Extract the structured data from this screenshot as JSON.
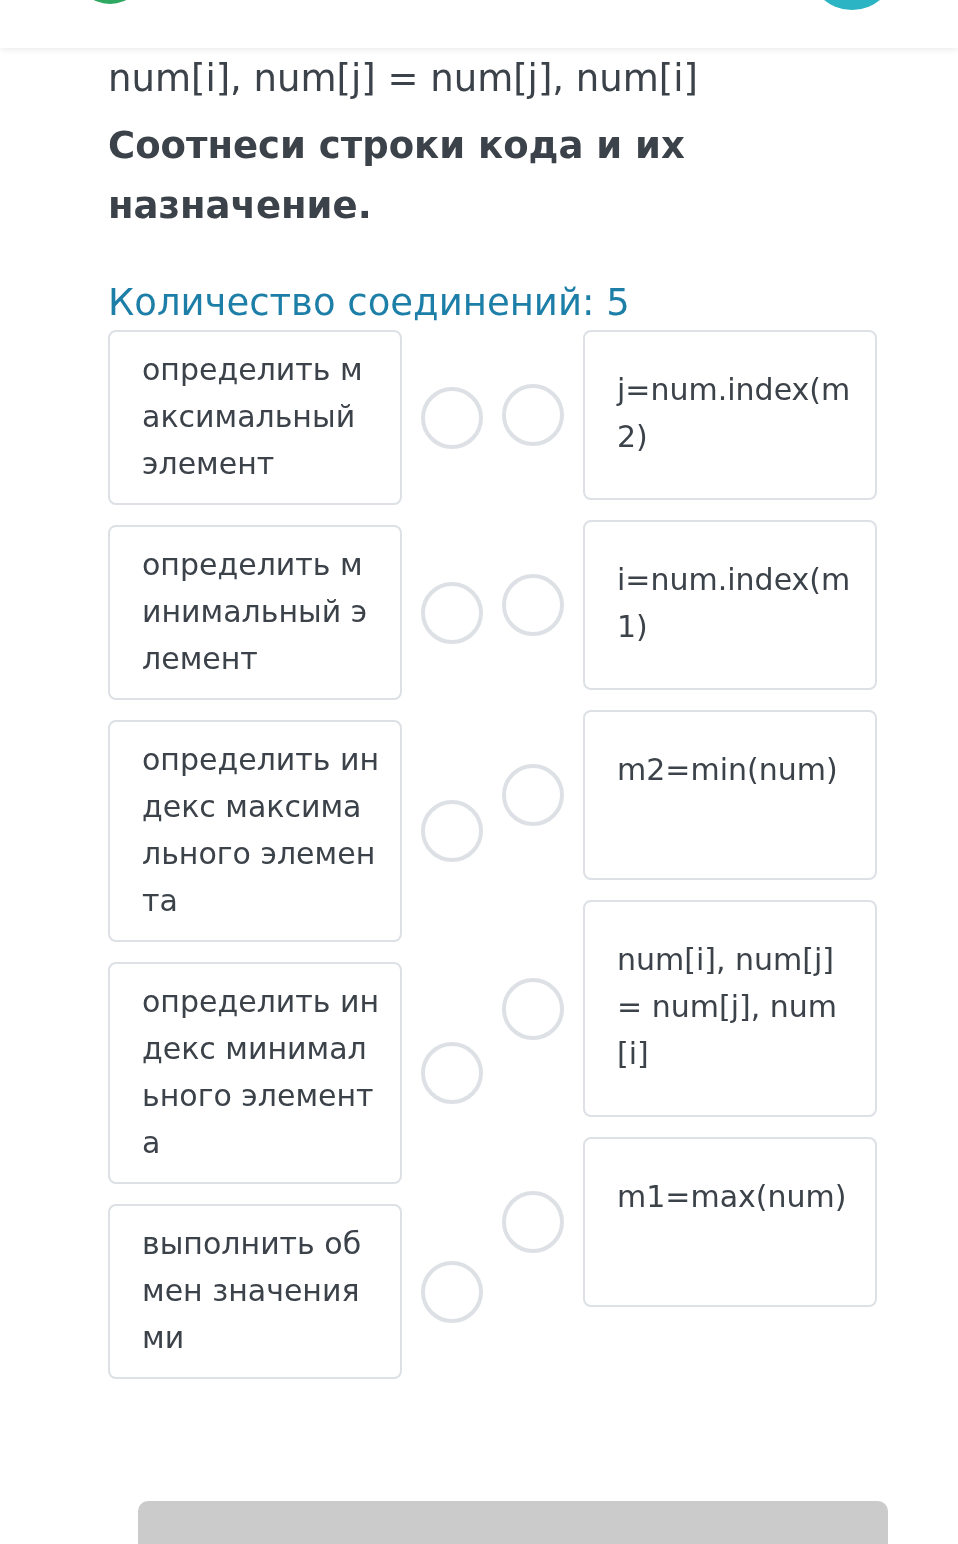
{
  "code_line": "num[i], num[j] = num[j], num[i]",
  "task": "Соотнеси строки кода и их назначение.",
  "connections_count": "Количество соединений: 5",
  "left_items": [
    {
      "text": "определить максимальный элемент"
    },
    {
      "text": "определить минимальный элемент"
    },
    {
      "text": "определить индекс максимального элемента"
    },
    {
      "text": "определить индекс минимального элемента"
    },
    {
      "text": "выполнить обмен значениями"
    }
  ],
  "right_items": [
    {
      "text": "j=num.index(m2)"
    },
    {
      "text": "i=num.index(m1)"
    },
    {
      "text": "m2=min(num)"
    },
    {
      "text": "num[i], num[j] = num[j], num[i]"
    },
    {
      "text": "m1=max(num)"
    }
  ]
}
